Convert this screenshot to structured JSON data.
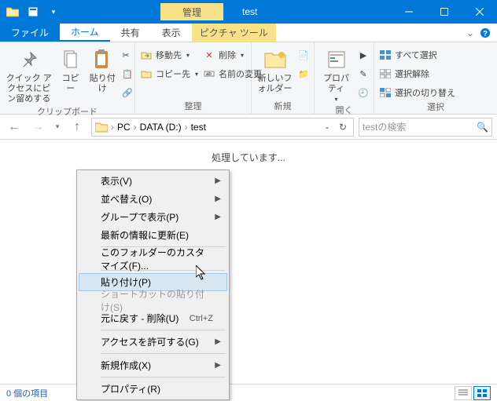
{
  "window": {
    "context_tab": "管理",
    "title": "test",
    "min_tip": "最小化",
    "max_tip": "最大化",
    "close_tip": "閉じる"
  },
  "tabs": {
    "file": "ファイル",
    "home": "ホーム",
    "share": "共有",
    "view": "表示",
    "picture_tools": "ピクチャ ツール"
  },
  "ribbon": {
    "clipboard": {
      "pin": "クイック アクセスにピン留めする",
      "copy": "コピー",
      "paste": "貼り付け",
      "label": "クリップボード"
    },
    "organize": {
      "move_to": "移動先",
      "copy_to": "コピー先",
      "delete": "削除",
      "rename": "名前の変更",
      "label": "整理"
    },
    "new": {
      "new_folder": "新しいフォルダー",
      "label": "新規"
    },
    "open": {
      "properties": "プロパティ",
      "label": "開く"
    },
    "select": {
      "all": "すべて選択",
      "none": "選択解除",
      "invert": "選択の切り替え",
      "label": "選択"
    }
  },
  "breadcrumb": {
    "pc": "PC",
    "drive": "DATA (D:)",
    "folder": "test"
  },
  "search": {
    "placeholder": "testの検索"
  },
  "content": {
    "processing": "処理しています..."
  },
  "status": {
    "items": "0 個の項目"
  },
  "context_menu": {
    "view": "表示(V)",
    "sort": "並べ替え(O)",
    "group": "グループで表示(P)",
    "refresh": "最新の情報に更新(E)",
    "customize": "このフォルダーのカスタマイズ(F)...",
    "paste": "貼り付け(P)",
    "paste_shortcut": "ショートカットの貼り付け(S)",
    "undo": "元に戻す - 削除(U)",
    "undo_key": "Ctrl+Z",
    "grant_access": "アクセスを許可する(G)",
    "new": "新規作成(X)",
    "properties": "プロパティ(R)"
  }
}
